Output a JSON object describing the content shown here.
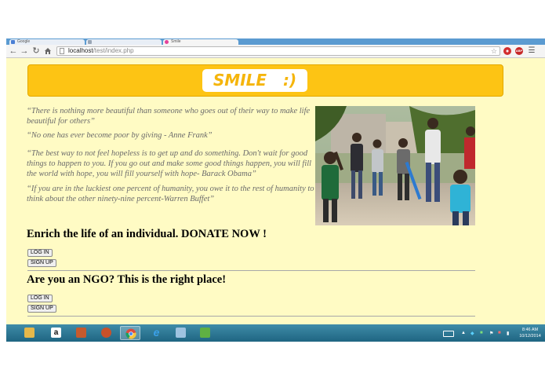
{
  "browser": {
    "tabs": [
      {
        "label": "Google",
        "favicon_color": "#4a7fd4"
      },
      {
        "label": "",
        "favicon_color": "#9aa6b5"
      },
      {
        "label": "Smile",
        "favicon_color": "#e4429a"
      }
    ],
    "url": {
      "host": "localhost",
      "path": "/test/index.php"
    },
    "extensions": [
      {
        "label": "",
        "color": "#d22e2e"
      },
      {
        "label": "ABP",
        "color": "#c62828"
      }
    ]
  },
  "page": {
    "logo": "SMILE   :)",
    "quotes": [
      "“There is nothing more beautiful than someone who goes out of their way to make life beautiful for others”",
      "“No one has ever become poor by giving - Anne Frank”",
      "“The best way to not feel hopeless is to get up and do something. Don't wait for good things to happen to you. If you go out and make some good things happen, you will fill the world with hope, you will fill yourself with hope- Barack Obama”",
      "“If you are in the luckiest one percent of humanity, you owe it to the rest of humanity to think about the other ninety-nine percent-Warren Buffet”"
    ],
    "sections": [
      {
        "heading": "Enrich the life of an individual. DONATE NOW !",
        "login_label": "LOG IN",
        "signup_label": "SIGN UP"
      },
      {
        "heading": "Are you an NGO? This is the right place!",
        "login_label": "LOG IN",
        "signup_label": "SIGN UP"
      }
    ]
  },
  "taskbar": {
    "apps": [
      {
        "name": "file-explorer-icon",
        "glyph": "",
        "color": "#e6b84a"
      },
      {
        "name": "amazon-icon",
        "glyph": "a",
        "color": "#ffffff"
      },
      {
        "name": "photos-icon",
        "glyph": "",
        "color": "#c65a2e"
      },
      {
        "name": "paint-icon",
        "glyph": "",
        "color": "#c9512a"
      },
      {
        "name": "chrome-icon",
        "glyph": "",
        "color": "#e0a82e"
      },
      {
        "name": "internet-explorer-icon",
        "glyph": "e",
        "color": "#3aa0e8"
      },
      {
        "name": "notepad-icon",
        "glyph": "",
        "color": "#9fc3e0"
      },
      {
        "name": "image-viewer-icon",
        "glyph": "",
        "color": "#5fb043"
      }
    ],
    "time": "8:46 AM",
    "date": "10/12/2014"
  }
}
